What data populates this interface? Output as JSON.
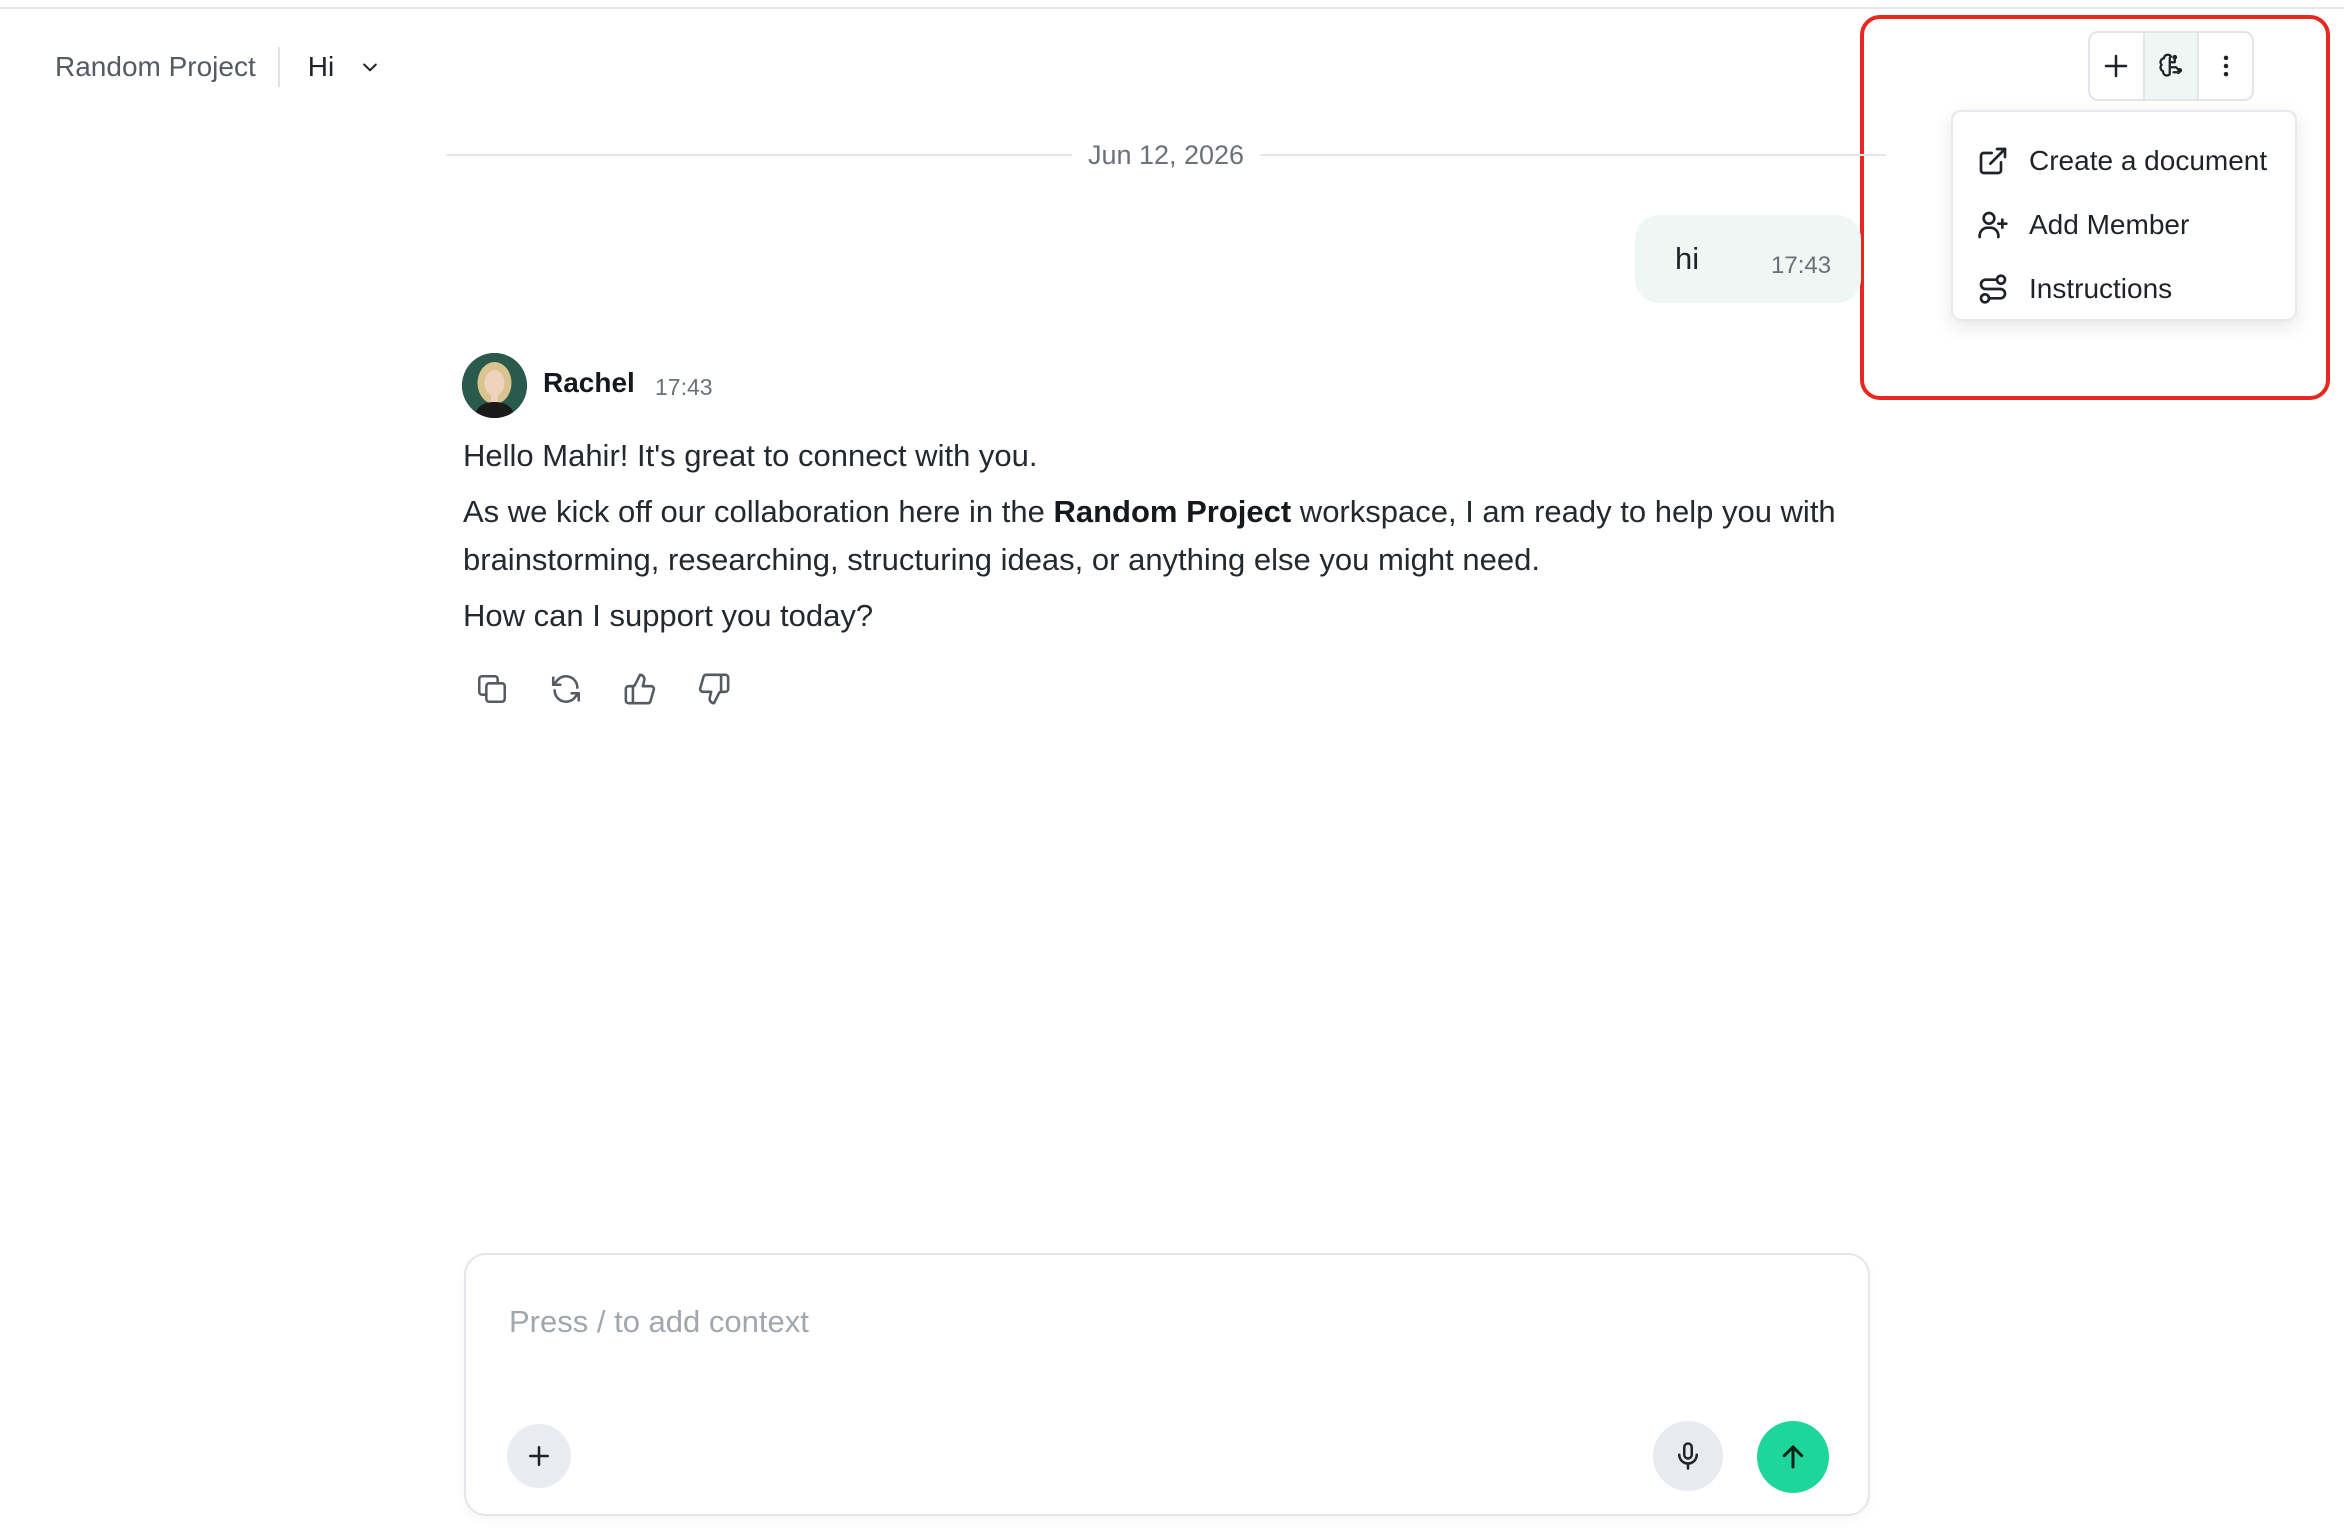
{
  "header": {
    "project_name": "Random Project",
    "chat_title": "Hi"
  },
  "toolbar": {
    "icons": [
      "plus-icon",
      "brain-icon",
      "more-vertical-icon"
    ]
  },
  "menu": {
    "items": [
      {
        "label": "Create a document",
        "icon": "external-link-icon"
      },
      {
        "label": "Add Member",
        "icon": "user-plus-icon"
      },
      {
        "label": "Instructions",
        "icon": "route-icon"
      }
    ]
  },
  "conversation": {
    "date": "Jun 12, 2026",
    "user_message": {
      "text": "hi",
      "time": "17:43"
    },
    "assistant_message": {
      "sender": "Rachel",
      "time": "17:43",
      "para1": "Hello Mahir! It's great to connect with you.",
      "para2_before": "As we kick off our collaboration here in the ",
      "para2_bold": "Random Project",
      "para2_after": " workspace, I am ready to help you with brainstorming, researching, structuring ideas, or anything else you might need.",
      "para3": "How can I support you today?"
    },
    "actions": [
      "copy-icon",
      "regenerate-icon",
      "thumbs-up-icon",
      "thumbs-down-icon"
    ]
  },
  "composer": {
    "placeholder": "Press / to add context",
    "value": ""
  },
  "colors": {
    "accent": "#1ed69a",
    "user_bubble": "#eef7f4",
    "highlight": "#e8281e"
  }
}
